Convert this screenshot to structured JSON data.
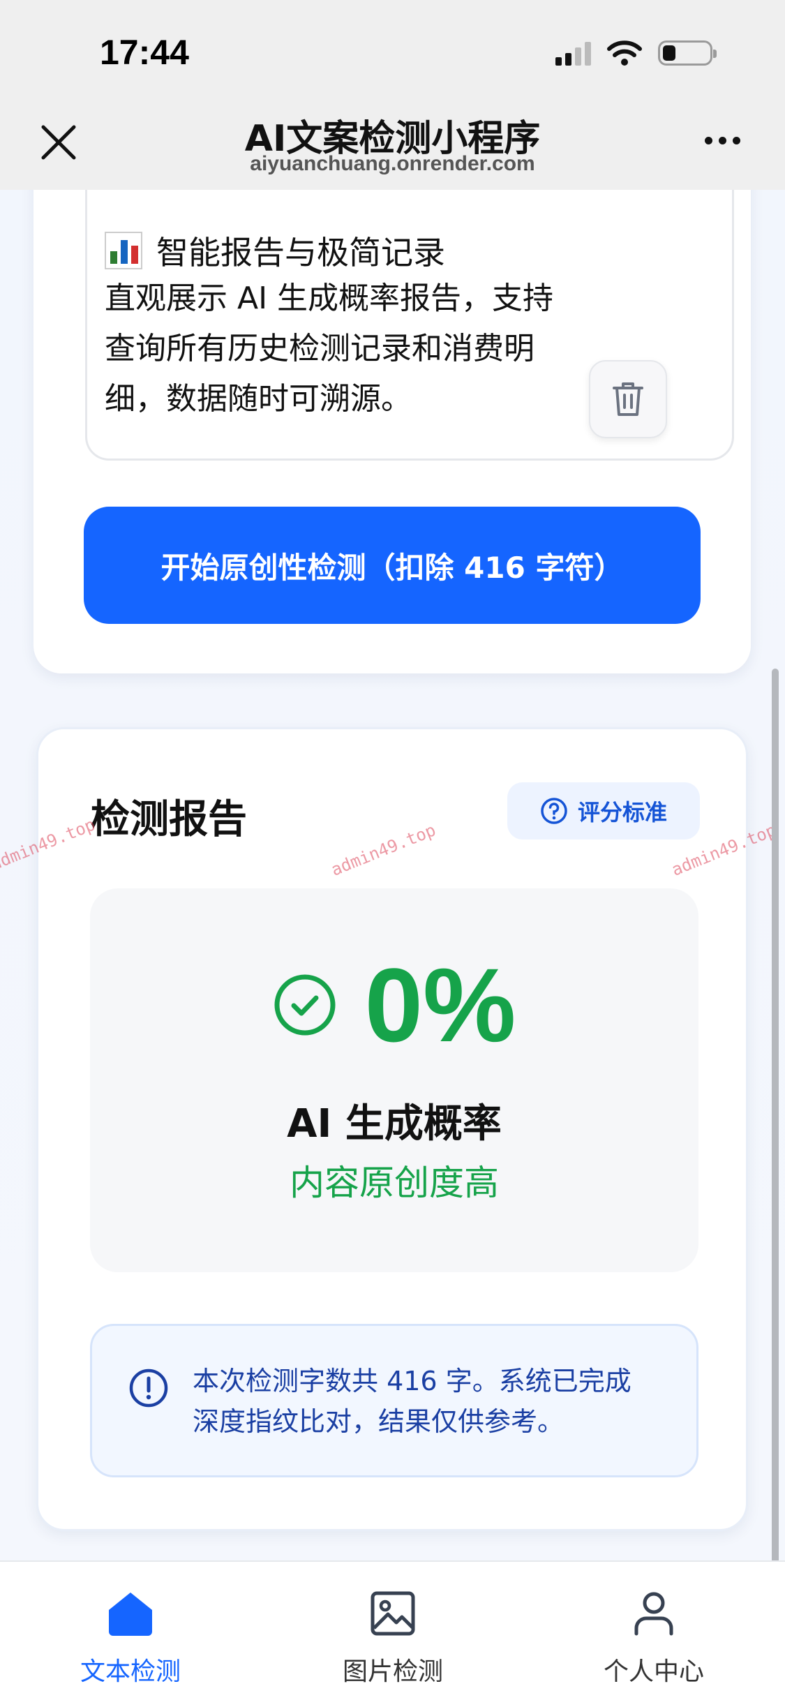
{
  "status_bar": {
    "time": "17:44"
  },
  "nav": {
    "title": "AI文案检测小程序",
    "subtitle": "aiyuanchuang.onrender.com"
  },
  "feature": {
    "title": "智能报告与极简记录",
    "description": "直观展示 AI 生成概率报告，支持查询所有历史检测记录和消费明细，数据随时可溯源。"
  },
  "primary_button": {
    "label": "开始原创性检测（扣除 416 字符）"
  },
  "report": {
    "title": "检测报告",
    "criteria_button": "评分标准",
    "score_value": "0%",
    "score_label": "AI 生成概率",
    "score_status": "内容原创度高",
    "notice": "本次检测字数共 416 字。系统已完成深度指纹比对，结果仅供参考。"
  },
  "watermark": {
    "text": "admin49.top"
  },
  "tabs": [
    {
      "label": "文本检测",
      "icon": "home-icon",
      "active": true
    },
    {
      "label": "图片检测",
      "icon": "image-icon",
      "active": false
    },
    {
      "label": "个人中心",
      "icon": "user-icon",
      "active": false
    }
  ],
  "colors": {
    "primary": "#1565ff",
    "success": "#16a34a",
    "notice_text": "#1a3fa3",
    "watermark": "#dc465a"
  }
}
